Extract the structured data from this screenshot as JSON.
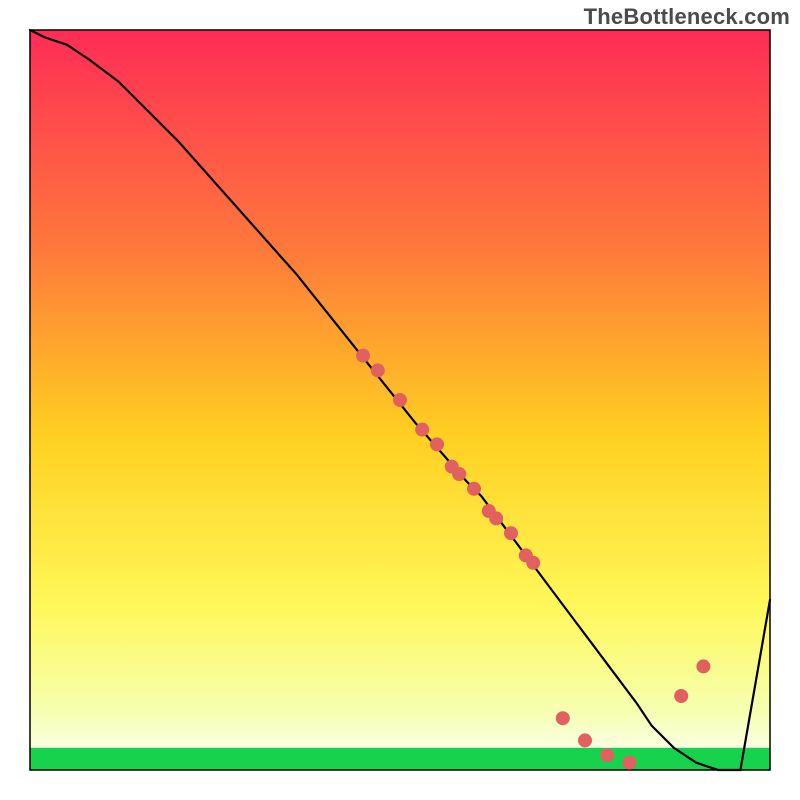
{
  "watermark": {
    "text": "TheBottleneck.com"
  },
  "chart_data": {
    "type": "line",
    "title": "",
    "xlabel": "",
    "ylabel": "",
    "xlim": [
      0,
      100
    ],
    "ylim": [
      0,
      100
    ],
    "grid": false,
    "series": [
      {
        "name": "curve",
        "x": [
          0,
          2,
          5,
          8,
          12,
          20,
          28,
          36,
          44,
          52,
          59,
          61,
          64,
          67,
          70,
          73,
          76,
          79,
          82,
          84,
          87,
          90,
          93,
          96,
          100
        ],
        "values": [
          100,
          99,
          98,
          96,
          93,
          85,
          76,
          67,
          57,
          47,
          39,
          37,
          33,
          29,
          25,
          21,
          17,
          13,
          9,
          6,
          3,
          1,
          0,
          0,
          23
        ]
      }
    ],
    "markers": {
      "name": "highlighted-points",
      "x": [
        45,
        47,
        50,
        53,
        55,
        57,
        58,
        60,
        62,
        63,
        65,
        67,
        68,
        72,
        75,
        78,
        81,
        88,
        91
      ],
      "values": [
        56,
        54,
        50,
        46,
        44,
        41,
        40,
        38,
        35,
        34,
        32,
        29,
        28,
        7,
        4,
        2,
        1,
        10,
        14
      ]
    },
    "green_band": {
      "from": 0,
      "to": 3
    },
    "gradient_colors": {
      "top": "#ff2c57",
      "mid_upper": "#ff7a3a",
      "mid": "#ffd021",
      "mid_lower": "#fff85a",
      "near_bottom": "#f6ffb0",
      "bottom": "#ffffff"
    },
    "marker_color": "#e0615f",
    "line_color": "#000000"
  }
}
